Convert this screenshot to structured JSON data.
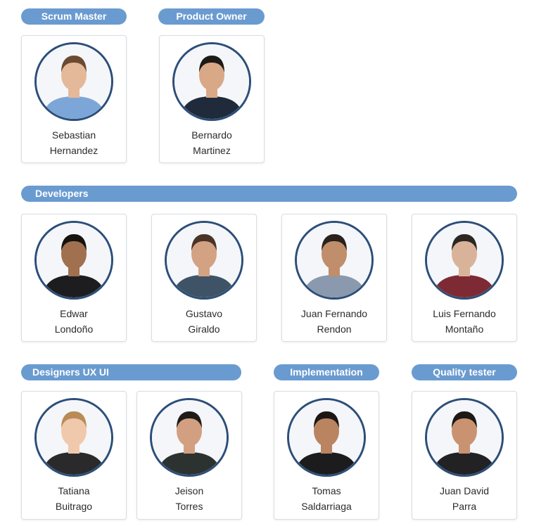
{
  "sections": {
    "scrum_master": "Scrum Master",
    "product_owner": "Product Owner",
    "developers": "Developers",
    "designers": "Designers UX UI",
    "implementation": "Implementation",
    "quality_tester": "Quality tester"
  },
  "members": [
    {
      "first": "Sebastian",
      "last": "Hernandez",
      "shirt": "#7da6d8",
      "skin": "#e3b99a",
      "hair": "#6b4a32"
    },
    {
      "first": "Bernardo",
      "last": "Martinez",
      "shirt": "#1f2a3a",
      "skin": "#d9a887",
      "hair": "#1e1a17"
    },
    {
      "first": "Edwar",
      "last": "Londoño",
      "shirt": "#1d1d1f",
      "skin": "#a0704f",
      "hair": "#161311"
    },
    {
      "first": "Gustavo",
      "last": "Giraldo",
      "shirt": "#3f5366",
      "skin": "#d3a283",
      "hair": "#4a3427"
    },
    {
      "first": "Juan Fernando",
      "last": "Rendon",
      "shirt": "#8a99ad",
      "skin": "#c08e6b",
      "hair": "#2a211c"
    },
    {
      "first": "Luis Fernando",
      "last": "Montaño",
      "shirt": "#7e2a34",
      "skin": "#d9b399",
      "hair": "#2d2723"
    },
    {
      "first": "Tatiana",
      "last": "Buitrago",
      "shirt": "#2a2a2c",
      "skin": "#f0c9ac",
      "hair": "#b98b57"
    },
    {
      "first": "Jeison",
      "last": "Torres",
      "shirt": "#2c3230",
      "skin": "#d2a081",
      "hair": "#1f1b18"
    },
    {
      "first": "Tomas",
      "last": "Saldarriaga",
      "shirt": "#1c1c1e",
      "skin": "#b9845f",
      "hair": "#1c1714"
    },
    {
      "first": "Juan David",
      "last": "Parra",
      "shirt": "#222224",
      "skin": "#c99371",
      "hair": "#1d1916"
    }
  ]
}
